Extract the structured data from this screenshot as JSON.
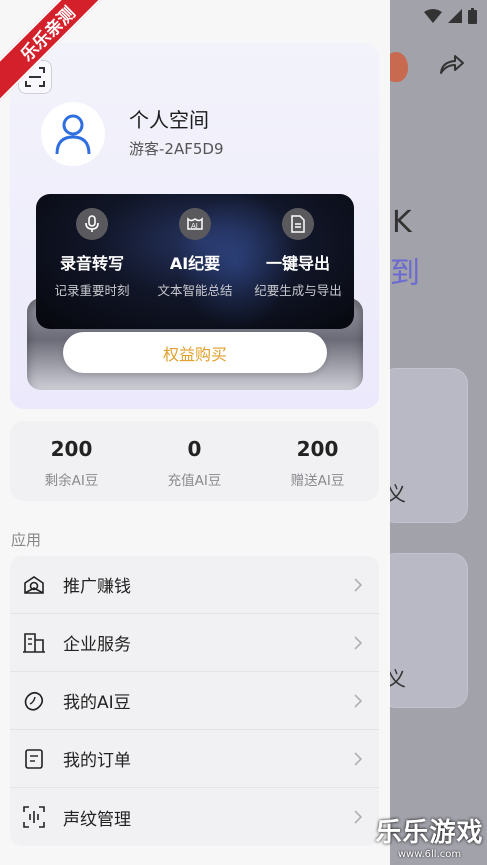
{
  "watermark": {
    "ribbon_text": "乐乐亲测",
    "bottom_text": "乐乐游戏",
    "bottom_url": "www.6ll.com"
  },
  "background": {
    "text_1": "K",
    "text_2": "到",
    "text_3": "义",
    "text_4": "义"
  },
  "profile": {
    "title": "个人空间",
    "username": "游客-2AF5D9"
  },
  "features": [
    {
      "title": "录音转写",
      "subtitle": "记录重要时刻",
      "icon": "microphone-icon"
    },
    {
      "title": "AI纪要",
      "subtitle": "文本智能总结",
      "icon": "ai-summary-icon"
    },
    {
      "title": "一键导出",
      "subtitle": "纪要生成与导出",
      "icon": "export-document-icon"
    }
  ],
  "buy_button": "权益购买",
  "stats": [
    {
      "value": "200",
      "label": "剩余AI豆"
    },
    {
      "value": "0",
      "label": "充值AI豆"
    },
    {
      "value": "200",
      "label": "赠送AI豆"
    }
  ],
  "section_label": "应用",
  "menu": [
    {
      "label": "推广赚钱",
      "icon": "promote-earn-icon"
    },
    {
      "label": "企业服务",
      "icon": "building-icon"
    },
    {
      "label": "我的AI豆",
      "icon": "bean-icon"
    },
    {
      "label": "我的订单",
      "icon": "order-icon"
    },
    {
      "label": "声纹管理",
      "icon": "voiceprint-icon"
    }
  ],
  "colors": {
    "accent_gold": "#e2a02d",
    "avatar_blue": "#2f6fe0",
    "drawer_bg": "#f7f7f8",
    "overlay_bg": "#a2a2ab"
  }
}
